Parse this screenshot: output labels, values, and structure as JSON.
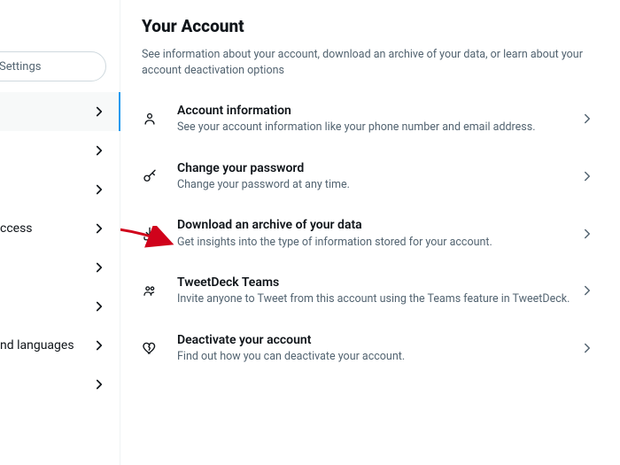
{
  "sidebar": {
    "search_placeholder": "Settings",
    "items": [
      {
        "label": ""
      },
      {
        "label": ""
      },
      {
        "label": ""
      },
      {
        "label": "ccess"
      },
      {
        "label": ""
      },
      {
        "label": ""
      },
      {
        "label": "nd languages"
      },
      {
        "label": ""
      }
    ]
  },
  "page": {
    "title": "Your Account",
    "description": "See information about your account, download an archive of your data, or learn about your account deactivation options"
  },
  "rows": [
    {
      "icon": "person-icon",
      "title": "Account information",
      "desc": "See your account information like your phone number and email address."
    },
    {
      "icon": "key-icon",
      "title": "Change your password",
      "desc": "Change your password at any time."
    },
    {
      "icon": "download-icon",
      "title": "Download an archive of your data",
      "desc": "Get insights into the type of information stored for your account."
    },
    {
      "icon": "teams-icon",
      "title": "TweetDeck Teams",
      "desc": "Invite anyone to Tweet from this account using the Teams feature in TweetDeck."
    },
    {
      "icon": "heart-break-icon",
      "title": "Deactivate your account",
      "desc": "Find out how you can deactivate your account."
    }
  ]
}
